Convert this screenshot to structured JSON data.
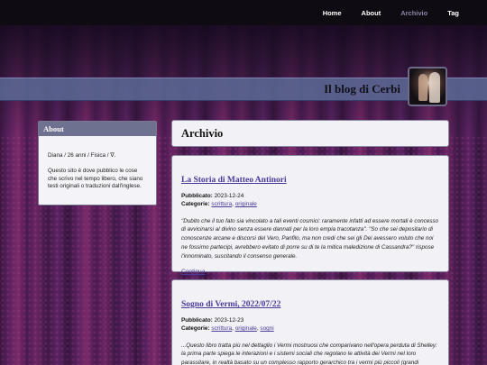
{
  "nav": {
    "items": [
      {
        "label": "Home",
        "active": false
      },
      {
        "label": "About",
        "active": false
      },
      {
        "label": "Archivio",
        "active": true
      },
      {
        "label": "Tag",
        "active": false
      }
    ]
  },
  "header": {
    "site_title": "Il blog di Cerbi"
  },
  "sidebar": {
    "title": "About",
    "bio": "Diana / 26 anni / Fisica / ∇.",
    "description": "Questo sito è dove pubblico le cose che scrivo nel tempo libero, che siano testi originali o traduzioni dall'inglese."
  },
  "main": {
    "page_title": "Archivio",
    "posts": [
      {
        "title": "La Storia di Matteo Antinori",
        "published_label": "Pubblicato:",
        "published": "2023-12-24",
        "categories_label": "Categorie:",
        "categories": [
          "scrittura",
          "originale"
        ],
        "excerpt": "\"Dubito che il tuo fato sia vincolato a tali eventi cosmici: raramente infatti ad essere mortali è concesso di avvicinarsi al divino senza essere dannati per la loro empia tracotanza\". \"So che sei depositario di conoscenze arcane e discorsi del Vero, Panfilo, ma non credi che sei gli Dei avessero voluto che noi ne fossimo partecipi, avrebbero evitato di porre su di te la mitica maledizione di Cassandra?\" rispose l'innominato, suscitando il consenso generale.",
        "more_label": "Continua"
      },
      {
        "title": "Sogno di Vermi, 2022/07/22",
        "published_label": "Pubblicato:",
        "published": "2023-12-23",
        "categories_label": "Categorie:",
        "categories": [
          "scrittura",
          "originale",
          "sogni"
        ],
        "excerpt": "...Questo libro tratta più nel dettaglio i Vermi mostruosi che comparivano nell'opera perduta di Shelley: la prima parte spiega le interazioni e i sistemi sociali che regolano le attività dei Vermi nel loro parassitare, in realtà basato su un complesso rapporto gerarchico tra i vermi più piccoli (grandi qualche centimetro) e i vermi più grandi (grandi anche decine e decine di metri)..."
      }
    ]
  },
  "colors": {
    "nav_bg": "#0e0c12",
    "nav_active": "#8a84a6",
    "link": "#4a3a9a",
    "header_band": "#5c6894",
    "sidebar_head": "#6e7290"
  }
}
